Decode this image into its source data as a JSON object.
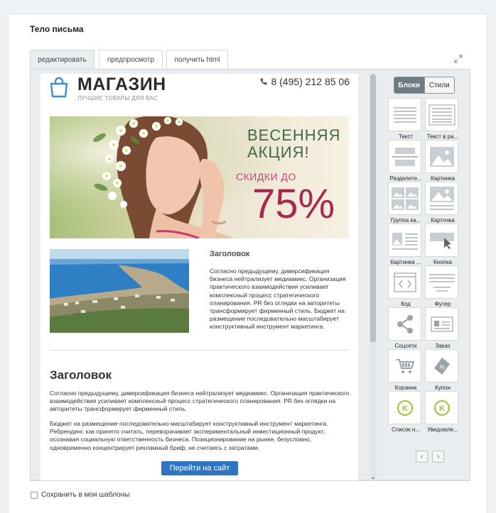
{
  "panel": {
    "title": "Тело письма"
  },
  "tabs": [
    {
      "label": "редактировать",
      "active": true
    },
    {
      "label": "предпросмотр",
      "active": false
    },
    {
      "label": "получить html",
      "active": false
    }
  ],
  "email": {
    "brand": "МАГАЗИН",
    "tagline": "ЛУЧШИЕ ТОВАРЫ ДЛЯ ВАС",
    "phone": "8 (495) 212 85 06",
    "banner": {
      "line1": "ВЕСЕННЯЯ",
      "line2": "АКЦИЯ!",
      "line3": "СКИДКИ ДО",
      "line4": "75%"
    },
    "section1": {
      "heading": "Заголовок",
      "text": "Согласно предыдущему, диверсификация бизнеса нейтрализует медиамикс. Организация практического взаимодействия усиливает комплексный процесс стратегического планирования. PR без оглядки на авторитеты трансформирует фирменный стиль. Бюджет на размещение последовательно масштабирует конструктивный инструмент маркетинга."
    },
    "section2": {
      "heading": "Заголовок",
      "p1": "Согласно предыдущему, диверсификация бизнеса нейтрализует медиамикс. Организация практического взаимодействия усиливает комплексный процесс стратегического планирования. PR без оглядки на авторитеты трансформирует фирменный стиль.",
      "p2": "Бюджет на размещение последовательно масштабирует конструктивный инструмент маркетинга. Ребрендинг, как принято считать, переворачивает экспериментальный инвестиционный продукт, осознавая социальную ответственность бизнеса. Позиционирование на рынке, безусловно, одновременно концентрирует рекламный бриф, не считаясь с затратами.",
      "button": "Перейти на сайт"
    }
  },
  "sidebar": {
    "toggle": {
      "blocks": "Блоки",
      "styles": "Стили"
    },
    "blocks": [
      {
        "label": "Текст",
        "icon": "text-block-icon"
      },
      {
        "label": "Текст в ра...",
        "icon": "text-frame-block-icon"
      },
      {
        "label": "Разделите...",
        "icon": "divider-block-icon"
      },
      {
        "label": "Картинка",
        "icon": "image-block-icon"
      },
      {
        "label": "Группа ка...",
        "icon": "image-group-block-icon"
      },
      {
        "label": "Карточка",
        "icon": "card-block-icon"
      },
      {
        "label": "Картинка ...",
        "icon": "image-text-block-icon"
      },
      {
        "label": "Кнопка",
        "icon": "button-block-icon"
      },
      {
        "label": "Код",
        "icon": "code-block-icon"
      },
      {
        "label": "Футер",
        "icon": "footer-block-icon"
      },
      {
        "label": "Соцсети",
        "icon": "share-icon"
      },
      {
        "label": "Заказ",
        "icon": "order-card-icon"
      },
      {
        "label": "Корзина",
        "icon": "cart-icon"
      },
      {
        "label": "Купон",
        "icon": "coupon-tag-icon"
      },
      {
        "label": "Список н...",
        "icon": "k-badge-icon"
      },
      {
        "label": "Уведомле...",
        "icon": "k-badge-icon"
      }
    ],
    "pager": {
      "prev": "‹",
      "next": "›"
    }
  },
  "save_template": {
    "label": "Сохранить в мои шаблоны",
    "checked": false
  },
  "colors": {
    "accent": "#2f74c0",
    "toggle_active": "#6f7b82",
    "banner_text": "#3d6a4d",
    "banner_discount": "#a8294f"
  }
}
